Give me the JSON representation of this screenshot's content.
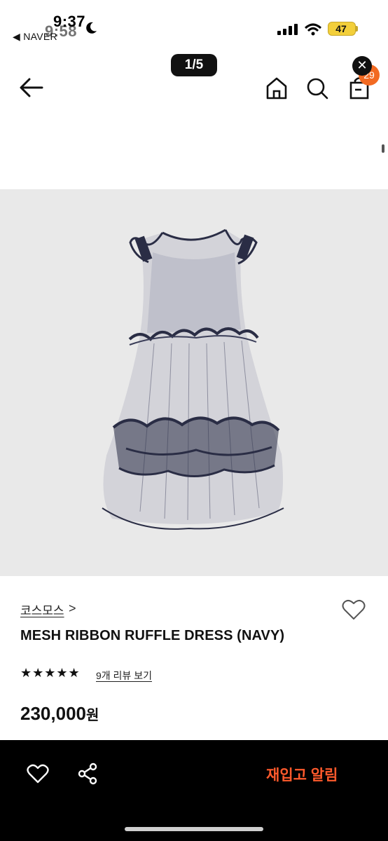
{
  "status_bar": {
    "time_back": "9:58",
    "time_front": "9:37",
    "back_app": "◀ NAVER",
    "battery": "47"
  },
  "pager": "1/5",
  "header": {
    "close_label": "✕",
    "cart_count": "29"
  },
  "product": {
    "brand": "코스모스",
    "brand_chevron": ">",
    "title": "MESH RIBBON RUFFLE DRESS (NAVY)",
    "rating_stars": "★★★★★",
    "review_link": "9개 리뷰 보기",
    "price": "230,000",
    "price_unit": "원"
  },
  "bottom_bar": {
    "restock_label": "재입고 알림"
  },
  "colors": {
    "accent_orange": "#f26a22",
    "restock_text": "#ff5a2c",
    "image_bg": "#e9e9e9",
    "dress_navy": "#2a2d45"
  }
}
